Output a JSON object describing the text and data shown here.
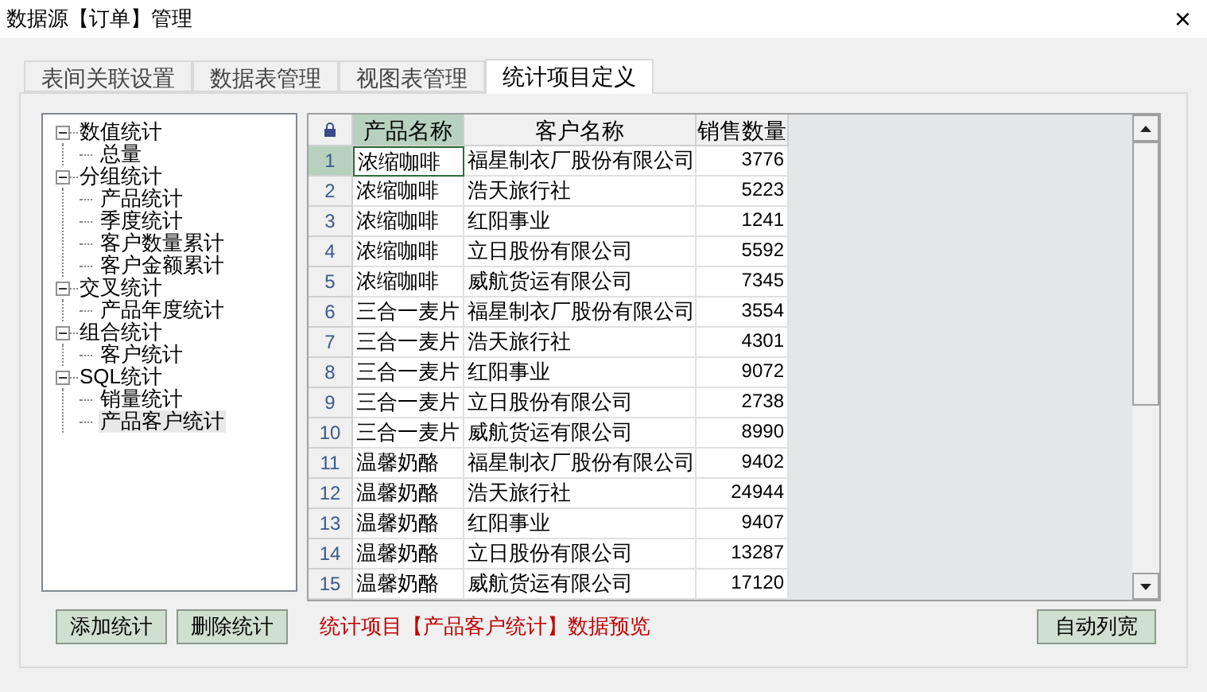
{
  "window": {
    "title": "数据源【订单】管理",
    "close": "×"
  },
  "tabs": [
    {
      "label": "表间关联设置",
      "selected": false
    },
    {
      "label": "数据表管理",
      "selected": false
    },
    {
      "label": "视图表管理",
      "selected": false
    },
    {
      "label": "统计项目定义",
      "selected": true
    }
  ],
  "tree": [
    {
      "label": "数值统计",
      "expanded": true,
      "selected": false,
      "children": [
        {
          "label": "总量",
          "selected": false
        }
      ]
    },
    {
      "label": "分组统计",
      "expanded": true,
      "selected": false,
      "children": [
        {
          "label": "产品统计",
          "selected": false
        },
        {
          "label": "季度统计",
          "selected": false
        },
        {
          "label": "客户数量累计",
          "selected": false
        },
        {
          "label": "客户金额累计",
          "selected": false
        }
      ]
    },
    {
      "label": "交叉统计",
      "expanded": true,
      "selected": false,
      "children": [
        {
          "label": "产品年度统计",
          "selected": false
        }
      ]
    },
    {
      "label": "组合统计",
      "expanded": true,
      "selected": false,
      "children": [
        {
          "label": "客户统计",
          "selected": false
        }
      ]
    },
    {
      "label": "SQL统计",
      "expanded": true,
      "selected": false,
      "children": [
        {
          "label": "销量统计",
          "selected": false
        },
        {
          "label": "产品客户统计",
          "selected": true
        }
      ]
    }
  ],
  "grid": {
    "columns": [
      {
        "label": "产品名称",
        "selected": true
      },
      {
        "label": "客户名称",
        "selected": false
      },
      {
        "label": "销售数量",
        "selected": false
      }
    ],
    "rows": [
      {
        "number": "1",
        "selected": true,
        "cells": [
          "浓缩咖啡",
          "福星制衣厂股份有限公司",
          "3776"
        ]
      },
      {
        "number": "2",
        "selected": false,
        "cells": [
          "浓缩咖啡",
          "浩天旅行社",
          "5223"
        ]
      },
      {
        "number": "3",
        "selected": false,
        "cells": [
          "浓缩咖啡",
          "红阳事业",
          "1241"
        ]
      },
      {
        "number": "4",
        "selected": false,
        "cells": [
          "浓缩咖啡",
          "立日股份有限公司",
          "5592"
        ]
      },
      {
        "number": "5",
        "selected": false,
        "cells": [
          "浓缩咖啡",
          "威航货运有限公司",
          "7345"
        ]
      },
      {
        "number": "6",
        "selected": false,
        "cells": [
          "三合一麦片",
          "福星制衣厂股份有限公司",
          "3554"
        ]
      },
      {
        "number": "7",
        "selected": false,
        "cells": [
          "三合一麦片",
          "浩天旅行社",
          "4301"
        ]
      },
      {
        "number": "8",
        "selected": false,
        "cells": [
          "三合一麦片",
          "红阳事业",
          "9072"
        ]
      },
      {
        "number": "9",
        "selected": false,
        "cells": [
          "三合一麦片",
          "立日股份有限公司",
          "2738"
        ]
      },
      {
        "number": "10",
        "selected": false,
        "cells": [
          "三合一麦片",
          "威航货运有限公司",
          "8990"
        ]
      },
      {
        "number": "11",
        "selected": false,
        "cells": [
          "温馨奶酪",
          "福星制衣厂股份有限公司",
          "9402"
        ]
      },
      {
        "number": "12",
        "selected": false,
        "cells": [
          "温馨奶酪",
          "浩天旅行社",
          "24944"
        ]
      },
      {
        "number": "13",
        "selected": false,
        "cells": [
          "温馨奶酪",
          "红阳事业",
          "9407"
        ]
      },
      {
        "number": "14",
        "selected": false,
        "cells": [
          "温馨奶酪",
          "立日股份有限公司",
          "13287"
        ]
      },
      {
        "number": "15",
        "selected": false,
        "cells": [
          "温馨奶酪",
          "威航货运有限公司",
          "17120"
        ]
      }
    ]
  },
  "buttons": [
    "添加统计",
    "删除统计"
  ],
  "preview_caption": "统计项目【产品客户统计】数据预览",
  "autofit_button": "自动列宽"
}
